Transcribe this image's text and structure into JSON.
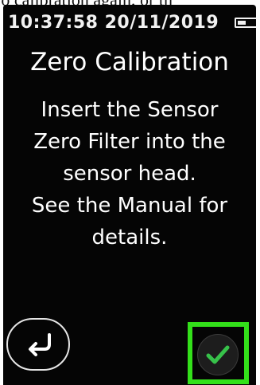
{
  "top_caption": "ro calibration again, or th",
  "status": {
    "datetime": "10:37:58  20/11/2019",
    "battery_icon": "battery-icon"
  },
  "screen": {
    "title": "Zero Calibration",
    "instruction_lines": [
      "Insert the Sensor",
      "Zero Filter into the",
      "sensor head.",
      "See the Manual for",
      "details."
    ]
  },
  "controls": {
    "back_icon": "return-arrow-icon",
    "confirm_icon": "checkmark-icon"
  },
  "colors": {
    "screen_background": "#050505",
    "text": "#ffffff",
    "checkmark": "#37c24a",
    "highlight": "#33e01a"
  }
}
